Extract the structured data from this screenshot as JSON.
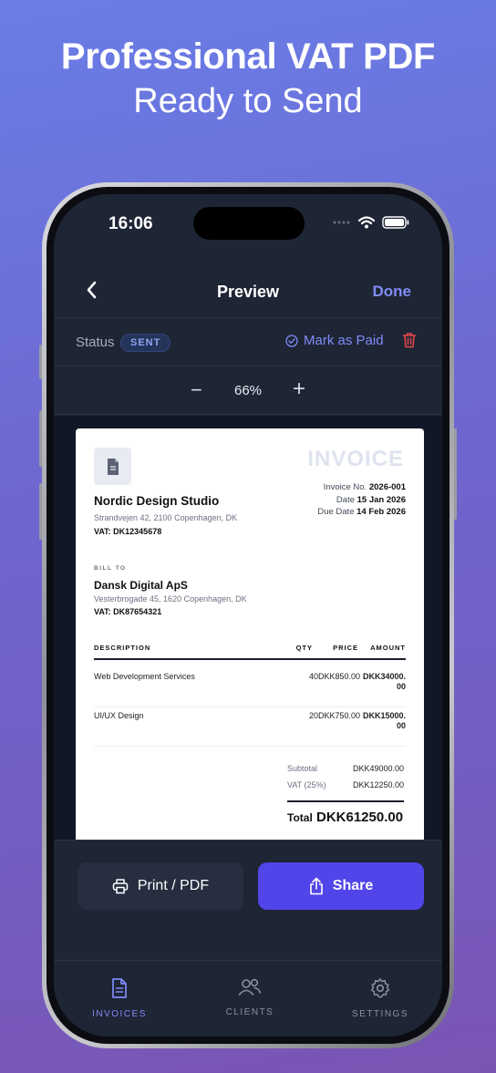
{
  "headline": {
    "title": "Professional VAT PDF",
    "subtitle": "Ready to Send"
  },
  "statusbar": {
    "time": "16:06"
  },
  "navbar": {
    "title": "Preview",
    "done_label": "Done"
  },
  "status_row": {
    "label": "Status",
    "badge": "SENT",
    "mark_paid_label": "Mark as Paid"
  },
  "zoom": {
    "minus": "−",
    "value": "66%",
    "plus": "+"
  },
  "invoice": {
    "heading": "INVOICE",
    "number_label": "Invoice No.",
    "number": "2026-001",
    "date_label": "Date",
    "date": "15 Jan 2026",
    "due_label": "Due Date",
    "due": "14 Feb 2026",
    "business": {
      "name": "Nordic Design Studio",
      "address": "Strandvejen 42, 2100 Copenhagen, DK",
      "vat": "VAT: DK12345678"
    },
    "bill_to_label": "BILL TO",
    "client": {
      "name": "Dansk Digital ApS",
      "address": "Vesterbrogade 45, 1620 Copenhagen, DK",
      "vat": "VAT: DK87654321"
    },
    "columns": {
      "description": "DESCRIPTION",
      "qty": "QTY",
      "price": "PRICE",
      "amount": "AMOUNT"
    },
    "items": [
      {
        "description": "Web Development Services",
        "qty": "40",
        "price": "DKK850.00",
        "amount": "DKK34000.00"
      },
      {
        "description": "UI/UX Design",
        "qty": "20",
        "price": "DKK750.00",
        "amount": "DKK15000.00"
      }
    ],
    "subtotal_label": "Subtotal",
    "subtotal": "DKK49000.00",
    "vat_label": "VAT (25%)",
    "vat_amount": "DKK12250.00",
    "total_label": "Total",
    "total": "DKK61250.00"
  },
  "actions": {
    "print_label": "Print / PDF",
    "share_label": "Share"
  },
  "tabs": [
    {
      "label": "INVOICES",
      "icon": "document-icon",
      "active": true
    },
    {
      "label": "CLIENTS",
      "icon": "people-icon",
      "active": false
    },
    {
      "label": "SETTINGS",
      "icon": "gear-icon",
      "active": false
    }
  ],
  "colors": {
    "accent": "#7f8cf7",
    "share_button": "#5045e8",
    "delete": "#e0464b",
    "screen_bg": "#1e2535"
  }
}
